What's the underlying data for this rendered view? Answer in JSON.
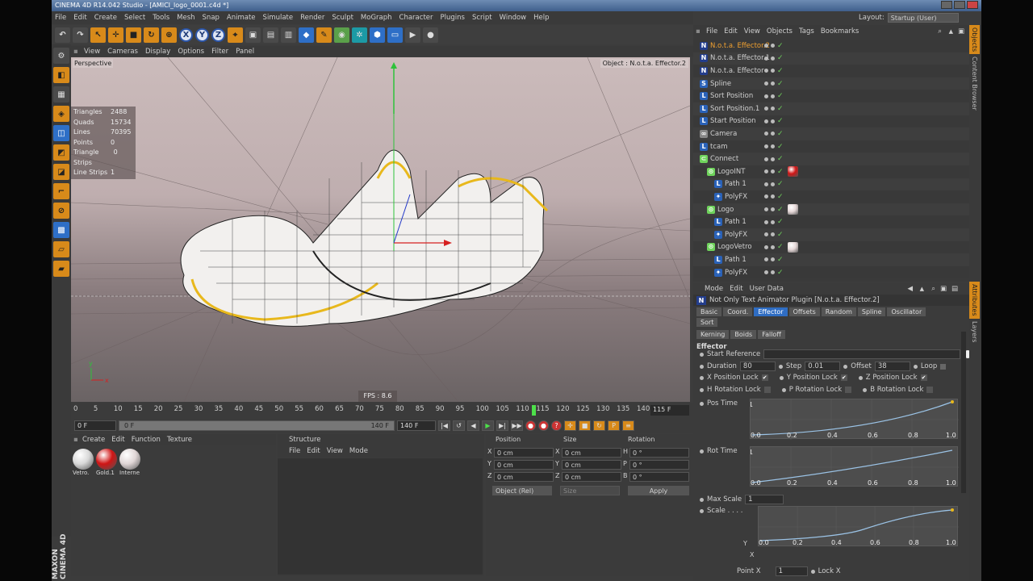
{
  "window_title": "CINEMA 4D R14.042 Studio - [AMICI_logo_0001.c4d *]",
  "menu": [
    "File",
    "Edit",
    "Create",
    "Select",
    "Tools",
    "Mesh",
    "Snap",
    "Animate",
    "Simulate",
    "Render",
    "Sculpt",
    "MoGraph",
    "Character",
    "Plugins",
    "Script",
    "Window",
    "Help"
  ],
  "layout": {
    "label": "Layout:",
    "value": "Startup (User)"
  },
  "viewport": {
    "menu": [
      "View",
      "Cameras",
      "Display",
      "Options",
      "Filter",
      "Panel"
    ],
    "name": "Perspective",
    "object_label": "Object : N.o.t.a. Effector.2",
    "stats": [
      {
        "k": "Triangles",
        "v": "2488"
      },
      {
        "k": "Quads",
        "v": "15734"
      },
      {
        "k": "Lines",
        "v": "70395"
      },
      {
        "k": "Points",
        "v": "0"
      },
      {
        "k": "Triangle Strips",
        "v": "0"
      },
      {
        "k": "Line Strips",
        "v": "1"
      }
    ],
    "fps": "FPS : 8.6",
    "axis_y": "y",
    "axis_x": "x"
  },
  "timeline": {
    "ticks": [
      "0",
      "5",
      "10",
      "15",
      "20",
      "25",
      "30",
      "35",
      "40",
      "45",
      "50",
      "55",
      "60",
      "65",
      "70",
      "75",
      "80",
      "85",
      "90",
      "95",
      "100",
      "105",
      "110",
      "115",
      "120",
      "125",
      "130",
      "135",
      "140"
    ],
    "current": "115",
    "frame_display": "115 F",
    "start": "0 F",
    "range_start": "0 F",
    "range_end": "140 F",
    "end": "140 F"
  },
  "material_manager": {
    "menu": [
      "Create",
      "Edit",
      "Function",
      "Texture"
    ],
    "materials": [
      {
        "name": "Vetro.",
        "color": "#d9d9d9"
      },
      {
        "name": "Gold.1",
        "color": "#d01515"
      },
      {
        "name": "Interne",
        "color": "#e0d6d6"
      }
    ]
  },
  "structure": {
    "title": "Structure",
    "menu": [
      "File",
      "Edit",
      "View",
      "Mode"
    ]
  },
  "coordinates": {
    "headers": [
      "Position",
      "Size",
      "Rotation"
    ],
    "rows": [
      {
        "a": "X",
        "p": "0 cm",
        "b": "X",
        "s": "0 cm",
        "c": "H",
        "r": "0 °"
      },
      {
        "a": "Y",
        "p": "0 cm",
        "b": "Y",
        "s": "0 cm",
        "c": "P",
        "r": "0 °"
      },
      {
        "a": "Z",
        "p": "0 cm",
        "b": "Z",
        "s": "0 cm",
        "c": "B",
        "r": "0 °"
      }
    ],
    "mode": "Object (Rel)",
    "size_mode": "Size",
    "apply": "Apply"
  },
  "object_manager": {
    "menu": [
      "File",
      "Edit",
      "View",
      "Objects",
      "Tags",
      "Bookmarks"
    ],
    "objects": [
      {
        "name": "N.o.t.a. Effector.2",
        "indent": 0,
        "icon": "N",
        "selected": true,
        "tag": ""
      },
      {
        "name": "N.o.t.a. Effector.1",
        "indent": 0,
        "icon": "N",
        "selected": false,
        "tag": ""
      },
      {
        "name": "N.o.t.a. Effector",
        "indent": 0,
        "icon": "N",
        "selected": false,
        "tag": ""
      },
      {
        "name": "Spline",
        "indent": 0,
        "icon": "S",
        "selected": false,
        "tag": ""
      },
      {
        "name": "Sort Position",
        "indent": 0,
        "icon": "L",
        "selected": false,
        "tag": ""
      },
      {
        "name": "Sort Position.1",
        "indent": 0,
        "icon": "L",
        "selected": false,
        "tag": ""
      },
      {
        "name": "Start Position",
        "indent": 0,
        "icon": "L",
        "selected": false,
        "tag": ""
      },
      {
        "name": "Camera",
        "indent": 0,
        "icon": "C",
        "selected": false,
        "tag": ""
      },
      {
        "name": "tcam",
        "indent": 0,
        "icon": "L",
        "selected": false,
        "tag": ""
      },
      {
        "name": "Connect",
        "indent": 0,
        "icon": "K",
        "selected": false,
        "tag": ""
      },
      {
        "name": "LogoINT",
        "indent": 1,
        "icon": "G",
        "selected": false,
        "tag": "#d01515"
      },
      {
        "name": "Path 1",
        "indent": 2,
        "icon": "L",
        "selected": false,
        "tag": ""
      },
      {
        "name": "PolyFX",
        "indent": 2,
        "icon": "P",
        "selected": false,
        "tag": ""
      },
      {
        "name": "Logo",
        "indent": 1,
        "icon": "G",
        "selected": false,
        "tag": "#e6d8d8"
      },
      {
        "name": "Path 1",
        "indent": 2,
        "icon": "L",
        "selected": false,
        "tag": ""
      },
      {
        "name": "PolyFX",
        "indent": 2,
        "icon": "P",
        "selected": false,
        "tag": ""
      },
      {
        "name": "LogoVetro",
        "indent": 1,
        "icon": "G",
        "selected": false,
        "tag": "#e6d8d8"
      },
      {
        "name": "Path 1",
        "indent": 2,
        "icon": "L",
        "selected": false,
        "tag": ""
      },
      {
        "name": "PolyFX",
        "indent": 2,
        "icon": "P",
        "selected": false,
        "tag": ""
      }
    ]
  },
  "side_tabs_top": [
    "Objects",
    "Content Browser"
  ],
  "side_tabs_bottom": [
    "Attributes",
    "Layers"
  ],
  "attributes": {
    "menu": [
      "Mode",
      "Edit",
      "User Data"
    ],
    "plugin_title": "Not Only Text Animator Plugin [N.o.t.a. Effector.2]",
    "tabs_row1": [
      "Basic",
      "Coord.",
      "Effector",
      "Offsets",
      "Random",
      "Spline",
      "Oscillator",
      "Sort"
    ],
    "tabs_row2": [
      "Kerning",
      "Boids",
      "Falloff"
    ],
    "active_tab": "Effector",
    "section": "Effector",
    "start_reference": "Start Reference",
    "duration": {
      "label": "Duration",
      "value": "80"
    },
    "step": {
      "label": "Step",
      "value": "0.01"
    },
    "offset": {
      "label": "Offset",
      "value": "38"
    },
    "loop": "Loop",
    "locks_row1": [
      {
        "l": "X Position Lock",
        "v": "✔"
      },
      {
        "l": "Y Position Lock",
        "v": "✔"
      },
      {
        "l": "Z Position Lock",
        "v": "✔"
      }
    ],
    "locks_row2": [
      {
        "l": "H Rotation Lock",
        "v": ""
      },
      {
        "l": "P Rotation Lock",
        "v": ""
      },
      {
        "l": "B Rotation Lock",
        "v": ""
      }
    ],
    "pos_time": "Pos Time",
    "rot_time": "Rot Time",
    "max_scale": {
      "label": "Max Scale",
      "value": "1"
    },
    "scale": "Scale . . . .",
    "curve_ticks": [
      "0.0",
      "0.2",
      "0.4",
      "0.6",
      "0.8",
      "1.0"
    ],
    "curve_top": "1",
    "point_x": {
      "label": "Point X",
      "value": "1",
      "lock": "Lock X"
    },
    "curve_axis_y": "Y",
    "curve_axis_x": "X"
  }
}
